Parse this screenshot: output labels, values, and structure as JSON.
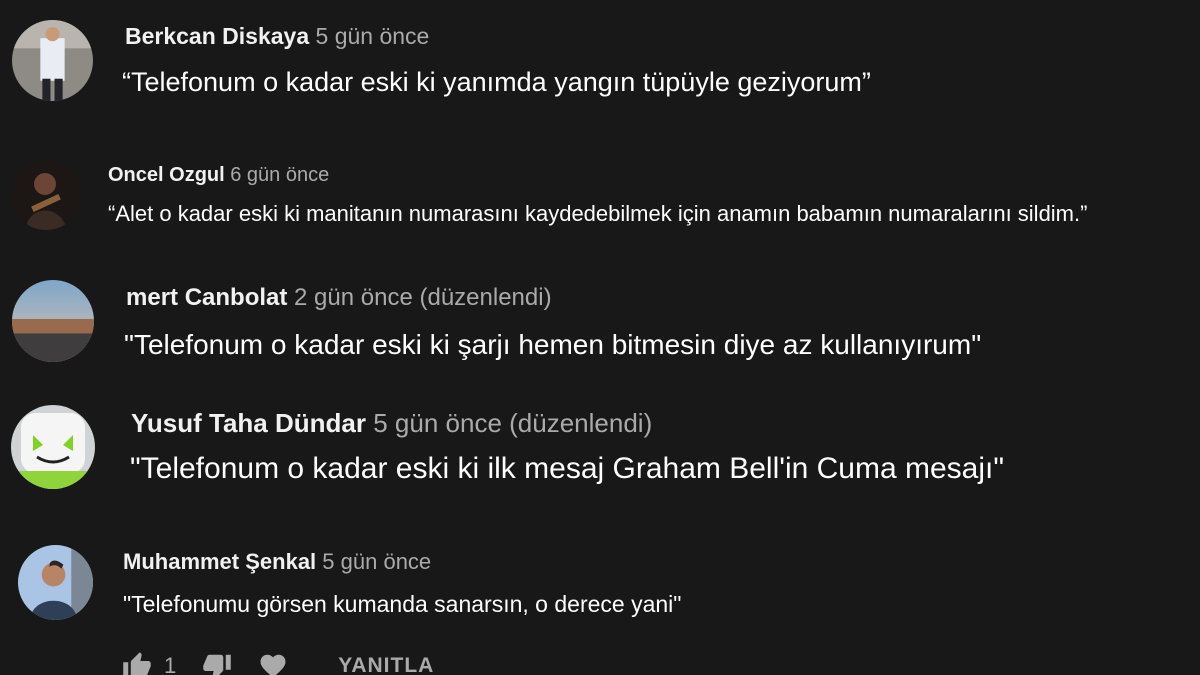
{
  "comments": [
    {
      "author": "Berkcan Diskaya",
      "time": "5 gün önce",
      "edited": "",
      "text": "“Telefonum o kadar eski ki yanımda yangın tüpüyle geziyorum”"
    },
    {
      "author": "Oncel Ozgul",
      "time": "6 gün önce",
      "edited": "",
      "text": "“Alet o kadar eski ki manitanın numarasını kaydedebilmek için anamın babamın numaralarını sildim.”"
    },
    {
      "author": "mert Canbolat",
      "time": "2 gün önce",
      "edited": "(düzenlendi)",
      "text": "\"Telefonum o kadar eski ki şarjı hemen bitmesin diye az kullanıyırum\""
    },
    {
      "author": "Yusuf Taha Dündar",
      "time": "5 gün önce",
      "edited": "(düzenlendi)",
      "text": "\"Telefonum o kadar eski ki ilk mesaj Graham Bell'in Cuma mesajı\""
    },
    {
      "author": "Muhammet Şenkal",
      "time": "5 gün önce",
      "edited": "",
      "text": "\"Telefonumu görsen kumanda sanarsın, o derece yani\""
    }
  ],
  "actions": {
    "like_count": "1",
    "reply_label": "YANITLA"
  },
  "icons": {
    "like": "thumbs-up-icon",
    "dislike": "thumbs-down-icon",
    "heart": "heart-icon"
  },
  "colors": {
    "background": "#181818",
    "author": "#f1f1f1",
    "meta": "#aaaaaa",
    "text": "#ffffff"
  }
}
